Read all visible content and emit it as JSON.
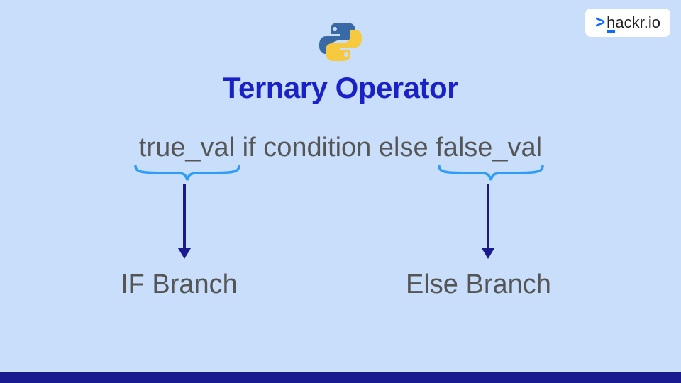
{
  "brand": {
    "chevron": ">",
    "name": "hackr.io"
  },
  "title": "Ternary Operator",
  "code_expression": "true_val if condition else false_val",
  "branches": {
    "if_label": "IF Branch",
    "else_label": "Else Branch"
  },
  "colors": {
    "background": "#c9defa",
    "title": "#1a22c7",
    "text": "#555",
    "brace": "#2e9df7",
    "arrow": "#1a1a8f",
    "bottom_bar": "#1a1a8f"
  }
}
